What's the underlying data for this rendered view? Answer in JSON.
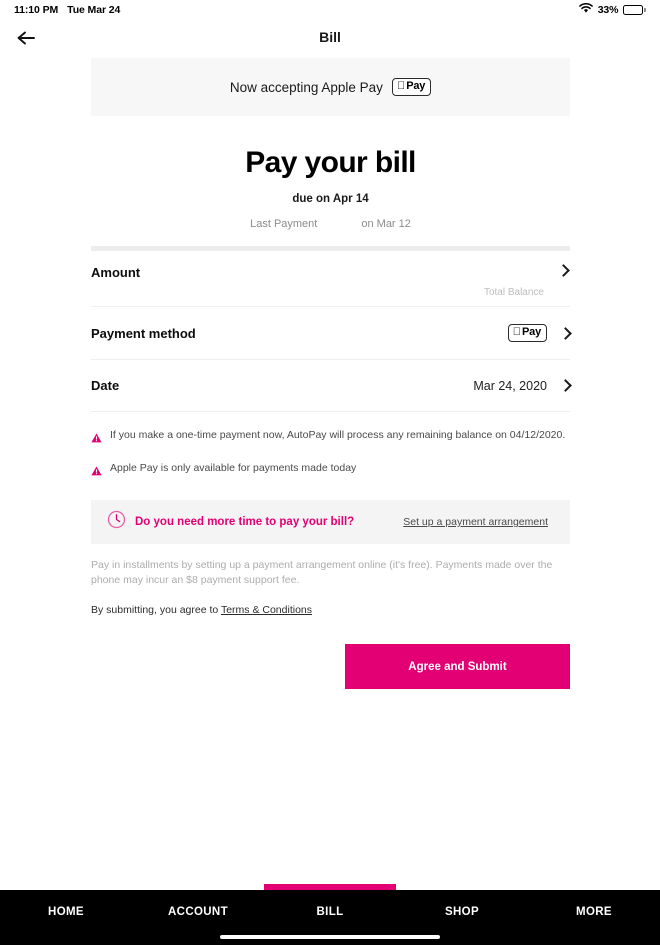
{
  "status_bar": {
    "time": "11:10 PM",
    "date": "Tue Mar 24",
    "wifi_icon": "wifi-icon",
    "battery_percent": "33%",
    "battery_level": 33
  },
  "nav": {
    "back_icon": "arrow-left-icon",
    "title": "Bill"
  },
  "apple_pay_banner": {
    "text": "Now accepting Apple Pay",
    "badge_logo": "apple-logo-icon",
    "badge_word": "Pay"
  },
  "hero": {
    "heading": "Pay your bill",
    "due": "due on Apr 14",
    "last_payment_label": "Last Payment",
    "last_payment_date": "on Mar 12"
  },
  "rows": {
    "amount": {
      "label": "Amount",
      "sub_note": "Total Balance",
      "chevron_icon": "chevron-right-icon"
    },
    "payment_method": {
      "label": "Payment method",
      "badge_logo": "apple-logo-icon",
      "badge_word": "Pay",
      "chevron_icon": "chevron-right-icon"
    },
    "date": {
      "label": "Date",
      "value": "Mar 24, 2020",
      "chevron_icon": "chevron-right-icon"
    }
  },
  "warnings": [
    {
      "icon": "warning-triangle-icon",
      "text": "If you make a one-time payment now, AutoPay will process any remaining balance on 04/12/2020."
    },
    {
      "icon": "warning-triangle-icon",
      "text": "Apple Pay is only available for payments made today"
    }
  ],
  "arrangement": {
    "icon": "clock-icon",
    "title": "Do you need more time to pay your bill?",
    "link": "Set up a payment arrangement"
  },
  "fineprint": "Pay in installments by setting up a payment arrangement online (it's free). Payments made over the phone may incur an $8 payment support fee.",
  "terms": {
    "prefix": "By submitting, you agree to ",
    "link": "Terms & Conditions"
  },
  "submit": {
    "label": "Agree and Submit"
  },
  "tab_bar": {
    "items": [
      {
        "label": "HOME",
        "active": false
      },
      {
        "label": "ACCOUNT",
        "active": false
      },
      {
        "label": "BILL",
        "active": true
      },
      {
        "label": "SHOP",
        "active": false
      },
      {
        "label": "MORE",
        "active": false
      }
    ]
  },
  "colors": {
    "magenta": "#e20074",
    "banner_gray": "#f7f7f7",
    "bar_gray": "#ededed",
    "tab_black": "#000000"
  }
}
